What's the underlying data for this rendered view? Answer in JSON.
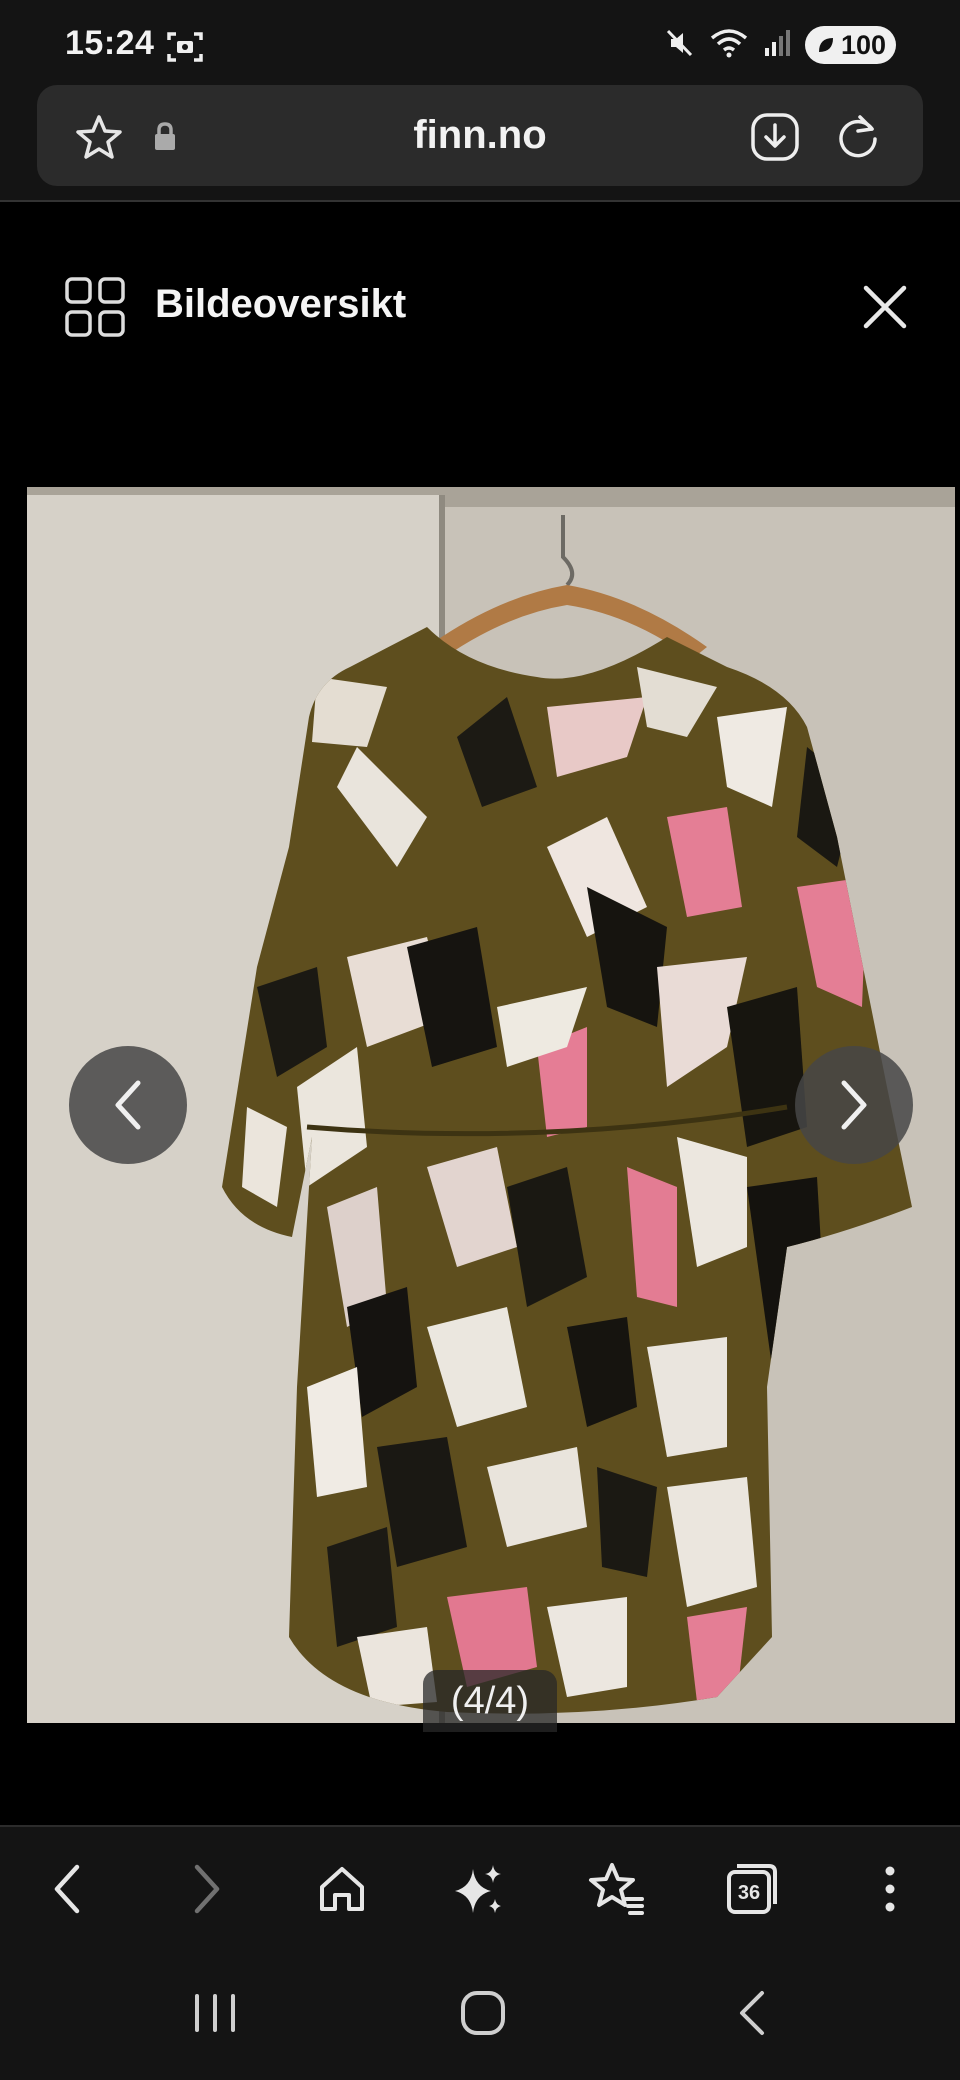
{
  "status_bar": {
    "time": "15:24",
    "battery": "100",
    "icons": [
      "screenshot-icon",
      "mute-icon",
      "wifi-icon",
      "signal-icon",
      "battery-icon"
    ]
  },
  "browser": {
    "url": "finn.no",
    "icons": [
      "star-icon",
      "lock-icon",
      "download-icon",
      "reload-icon"
    ]
  },
  "gallery": {
    "title": "Bildeoversikt",
    "counter": "(4/4)",
    "image_description_icon": "photo"
  },
  "toolbar": {
    "buttons": [
      "back-icon",
      "forward-icon",
      "home-icon",
      "sparkle-icon",
      "bookmarks-icon",
      "tabs-icon",
      "more-icon"
    ],
    "tab_count": "36"
  },
  "system_nav": {
    "buttons": [
      "recents-icon",
      "home-circle-icon",
      "back-chevron-icon"
    ]
  },
  "colors": {
    "background": "#000000",
    "chrome": "#141414",
    "url_bar": "#2b2b2b",
    "text": "#f2f2f2"
  }
}
